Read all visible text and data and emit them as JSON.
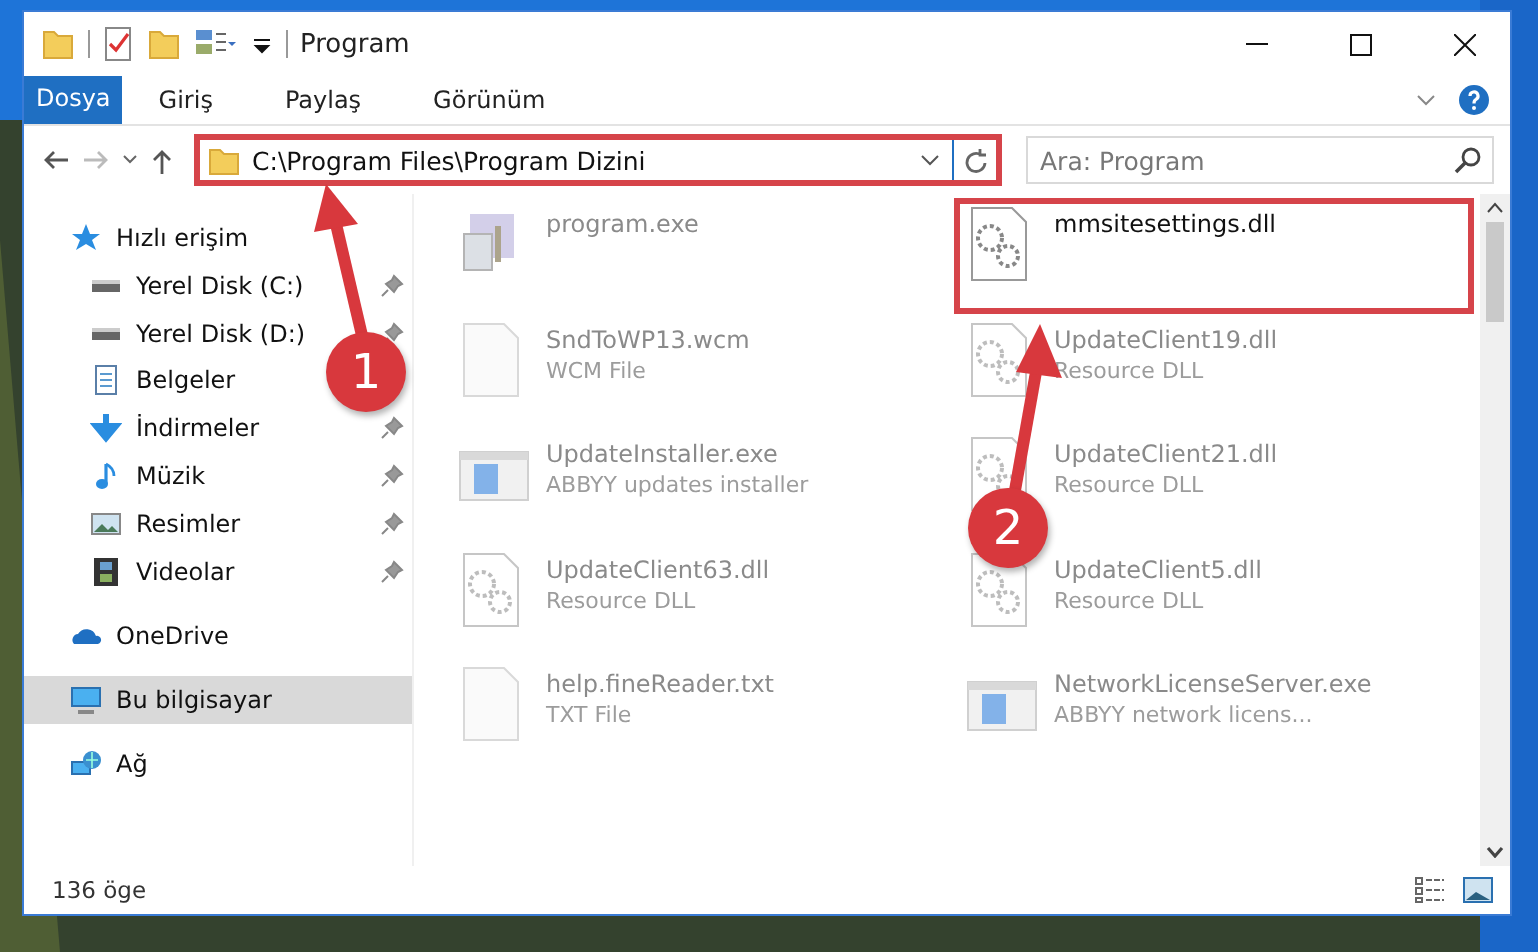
{
  "window": {
    "title": "Program"
  },
  "ribbon": {
    "tabs": [
      {
        "label": "Dosya",
        "kind": "file"
      },
      {
        "label": "Giriş",
        "kind": "tab"
      },
      {
        "label": "Paylaş",
        "kind": "tab"
      },
      {
        "label": "Görünüm",
        "kind": "tab"
      }
    ]
  },
  "address_bar": {
    "path": "C:\\Program Files\\Program Dizini",
    "highlighted": true
  },
  "search": {
    "placeholder": "Ara: Program"
  },
  "sidebar": {
    "items": [
      {
        "label": "Hızlı erişim",
        "kind": "star",
        "selected": false,
        "children": [
          {
            "label": "Yerel Disk (C:)",
            "kind": "drive",
            "pinned": true
          },
          {
            "label": "Yerel Disk (D:)",
            "kind": "drive",
            "pinned": true
          },
          {
            "label": "Belgeler",
            "kind": "documents",
            "pinned": false
          },
          {
            "label": "İndirmeler",
            "kind": "download",
            "pinned": true
          },
          {
            "label": "Müzik",
            "kind": "music",
            "pinned": true
          },
          {
            "label": "Resimler",
            "kind": "pictures",
            "pinned": true
          },
          {
            "label": "Videolar",
            "kind": "video",
            "pinned": true
          }
        ]
      },
      {
        "label": "OneDrive",
        "kind": "cloud",
        "selected": false
      },
      {
        "label": "Bu bilgisayar",
        "kind": "computer",
        "selected": true
      },
      {
        "label": "Ağ",
        "kind": "network",
        "selected": false
      }
    ]
  },
  "files": [
    {
      "name": "program.exe",
      "kind": "app",
      "dimmed": true,
      "highlighted": false
    },
    {
      "name": "mmsitesettings.dll",
      "kind": "dll",
      "dimmed": false,
      "highlighted": true
    },
    {
      "name": "SndToWP13.wcm",
      "type": "WCM File",
      "kind": "blank",
      "dimmed": true,
      "highlighted": false
    },
    {
      "name": "UpdateClient19.dll",
      "type": "Resource DLL",
      "kind": "dll",
      "dimmed": true,
      "highlighted": false
    },
    {
      "name": "UpdateInstaller.exe",
      "type": "ABBYY updates installer",
      "kind": "window",
      "dimmed": true,
      "highlighted": false
    },
    {
      "name": "UpdateClient21.dll",
      "type": "Resource DLL",
      "kind": "dll",
      "dimmed": true,
      "highlighted": false
    },
    {
      "name": "UpdateClient63.dll",
      "type": "Resource DLL",
      "kind": "dll",
      "dimmed": true,
      "highlighted": false
    },
    {
      "name": "UpdateClient5.dll",
      "type": "Resource DLL",
      "kind": "dll",
      "dimmed": true,
      "highlighted": false
    },
    {
      "name": "help.fineReader.txt",
      "type": "TXT File",
      "kind": "blank",
      "dimmed": true,
      "highlighted": false
    },
    {
      "name": "NetworkLicenseServer.exe",
      "type": "ABBYY network licens...",
      "kind": "window",
      "dimmed": true,
      "highlighted": false
    }
  ],
  "status_bar": {
    "count": "136 öge"
  },
  "callouts": [
    {
      "number": "1"
    },
    {
      "number": "2"
    }
  ]
}
